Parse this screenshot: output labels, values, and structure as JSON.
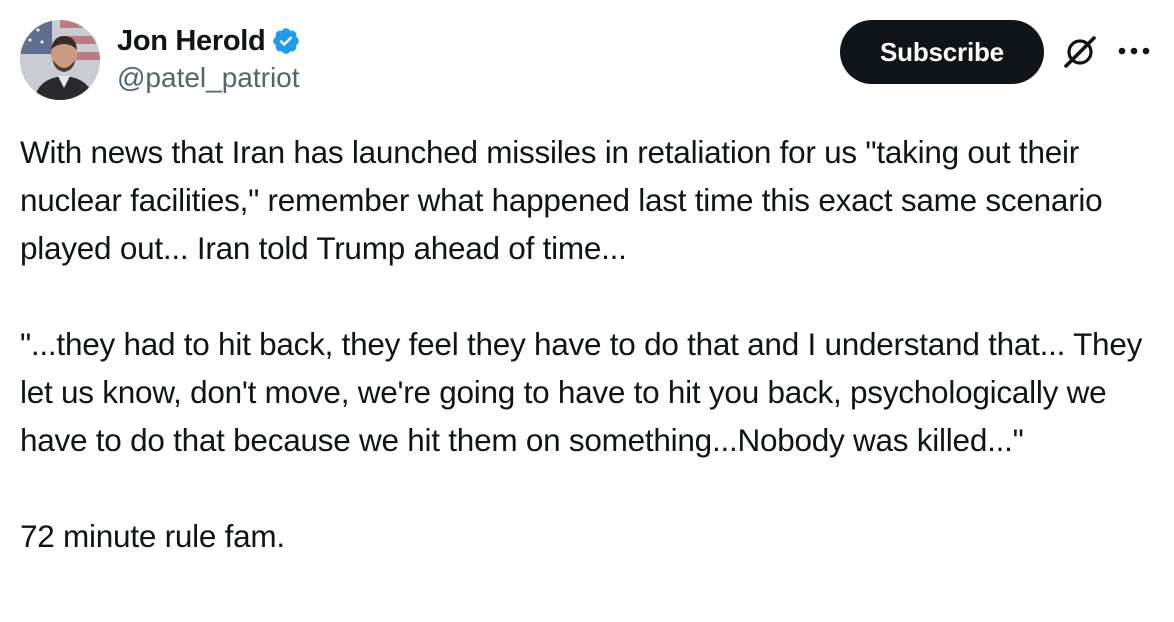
{
  "author": {
    "display_name": "Jon Herold",
    "handle": "@patel_patriot",
    "verified": true,
    "avatar_icon": "user-avatar-photo"
  },
  "header": {
    "subscribe_label": "Subscribe",
    "grok_icon": "grok-slash-icon",
    "more_icon": "more-horizontal-icon"
  },
  "colors": {
    "text": "#0f1419",
    "secondary_text": "#536471",
    "verified_blue": "#1d9bf0",
    "button_bg": "#0f1419"
  },
  "tweet": {
    "paragraphs": [
      "With news that Iran has launched missiles in retaliation for us \"taking out their nuclear facilities,\" remember what happened last time this exact same scenario played out... Iran told Trump ahead of time...",
      "\"...they had to hit back, they feel they have to do that and I understand that... They let us know, don't move, we're going to have to hit you back, psychologically we have to do that because we hit them on something...Nobody was killed...\"",
      "72 minute rule fam."
    ]
  }
}
